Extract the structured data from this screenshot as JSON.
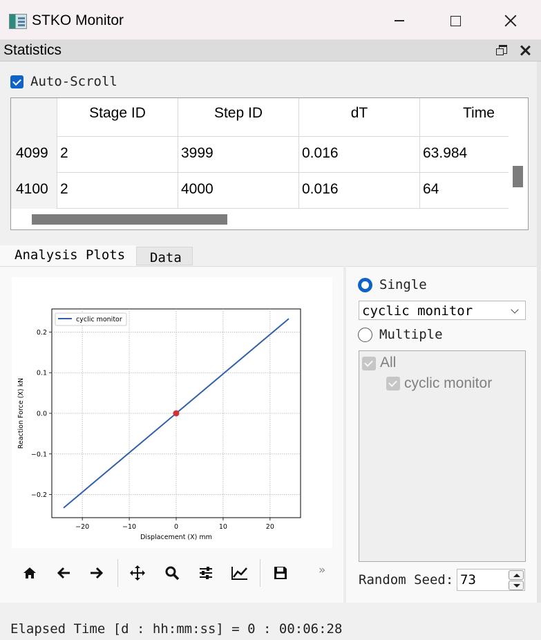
{
  "window": {
    "title": "STKO Monitor"
  },
  "dock": {
    "title": "Statistics"
  },
  "auto_scroll": {
    "label": "Auto-Scroll",
    "checked": true
  },
  "table": {
    "columns": [
      "Stage ID",
      "Step ID",
      "dT",
      "Time"
    ],
    "rows": [
      {
        "index": "4099",
        "cells": [
          "2",
          "3999",
          "0.016",
          "63.984"
        ]
      },
      {
        "index": "4100",
        "cells": [
          "2",
          "4000",
          "0.016",
          "64"
        ]
      }
    ]
  },
  "tabs": [
    {
      "label": "Analysis Plots",
      "active": true
    },
    {
      "label": "Data",
      "active": false
    }
  ],
  "mode": {
    "single_label": "Single",
    "multiple_label": "Multiple",
    "selected": "single",
    "combo_value": "cyclic monitor"
  },
  "tree": {
    "all_label": "All",
    "items": [
      {
        "label": "cyclic monitor",
        "checked": true
      }
    ]
  },
  "random_seed": {
    "label": "Random Seed:",
    "value": "73"
  },
  "status": {
    "elapsed": "Elapsed Time [d : hh:mm:ss] = 0 : 00:06:28"
  },
  "toolbar": {
    "icons": [
      "home-icon",
      "back-arrow-icon",
      "forward-arrow-icon",
      "pan-icon",
      "zoom-icon",
      "configure-subplots-icon",
      "edit-axis-icon",
      "save-icon",
      "more-icon"
    ],
    "more_label": "»"
  },
  "colors": {
    "accent": "#0f63c7",
    "series": "#3060aa",
    "marker": "#d0303a"
  },
  "chart_data": {
    "type": "line",
    "xlabel": "Displacement (X) mm",
    "ylabel": "Reaction Force (X) kN",
    "xlim": [
      -26.5,
      26.5
    ],
    "ylim": [
      -0.257,
      0.257
    ],
    "xticks": [
      -20,
      -10,
      0,
      10,
      20
    ],
    "xtick_labels": [
      "−20",
      "−10",
      "0",
      "10",
      "20"
    ],
    "yticks": [
      -0.2,
      -0.1,
      0.0,
      0.1,
      0.2
    ],
    "ytick_labels": [
      "−0.2",
      "−0.1",
      "0.0",
      "0.1",
      "0.2"
    ],
    "grid": true,
    "legend": "top-left",
    "series": [
      {
        "name": "cyclic monitor",
        "x": [
          -24,
          24
        ],
        "y": [
          -0.233,
          0.233
        ]
      }
    ],
    "current_point": {
      "x": 0,
      "y": 0
    }
  }
}
